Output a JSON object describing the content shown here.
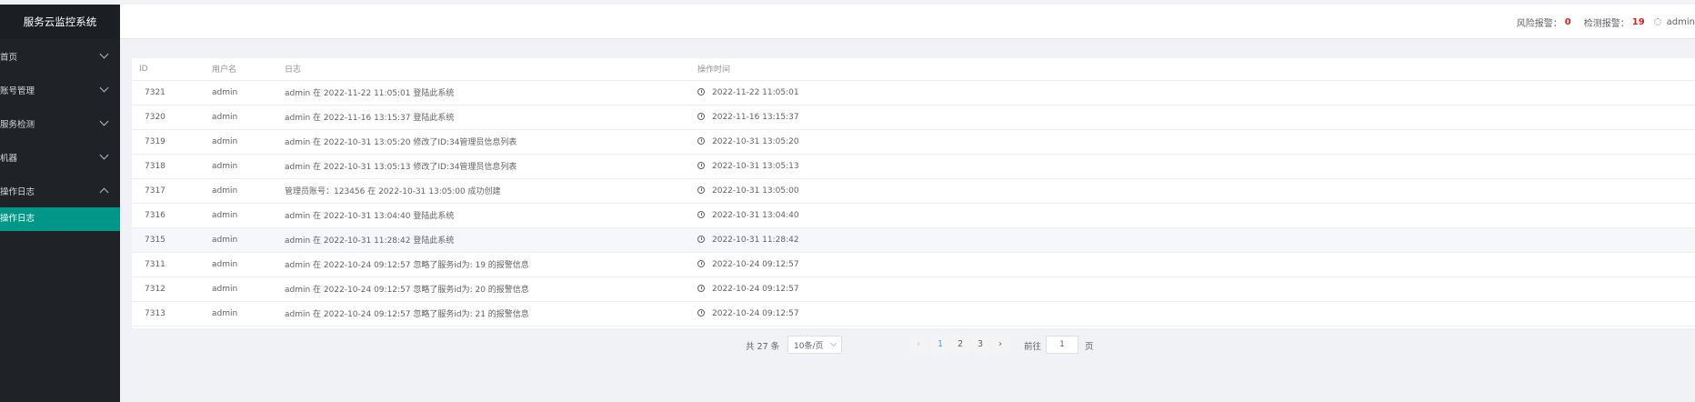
{
  "app": {
    "title": "服务云监控系统"
  },
  "sidebar": {
    "items": [
      {
        "label": "首页",
        "expanded": false
      },
      {
        "label": "账号管理",
        "expanded": false
      },
      {
        "label": "服务检测",
        "expanded": false
      },
      {
        "label": "机器",
        "expanded": false
      },
      {
        "label": "操作日志",
        "expanded": true
      }
    ],
    "submenu": {
      "label": "操作日志"
    },
    "active_color": "#009688"
  },
  "header": {
    "risk_label": "风险报警：",
    "risk_count": "0",
    "detect_label": "检测报警：",
    "detect_count": "19",
    "user": "admin"
  },
  "table": {
    "columns": [
      "ID",
      "用户名",
      "日志",
      "操作时间"
    ],
    "rows": [
      {
        "id": "7321",
        "user": "admin",
        "log": "admin 在 2022-11-22 11:05:01 登陆此系统",
        "time": "2022-11-22 11:05:01"
      },
      {
        "id": "7320",
        "user": "admin",
        "log": "admin 在 2022-11-16 13:15:37 登陆此系统",
        "time": "2022-11-16 13:15:37"
      },
      {
        "id": "7319",
        "user": "admin",
        "log": "admin 在 2022-10-31 13:05:20 修改了ID:34管理员信息列表",
        "time": "2022-10-31 13:05:20"
      },
      {
        "id": "7318",
        "user": "admin",
        "log": "admin 在 2022-10-31 13:05:13 修改了ID:34管理员信息列表",
        "time": "2022-10-31 13:05:13"
      },
      {
        "id": "7317",
        "user": "admin",
        "log": "管理员账号：123456 在 2022-10-31 13:05:00 成功创建",
        "time": "2022-10-31 13:05:00"
      },
      {
        "id": "7316",
        "user": "admin",
        "log": "admin 在 2022-10-31 13:04:40 登陆此系统",
        "time": "2022-10-31 13:04:40"
      },
      {
        "id": "7315",
        "user": "admin",
        "log": "admin 在 2022-10-31 11:28:42 登陆此系统",
        "time": "2022-10-31 11:28:42"
      },
      {
        "id": "7311",
        "user": "admin",
        "log": "admin 在 2022-10-24 09:12:57 忽略了服务id为: 19 的报警信息",
        "time": "2022-10-24 09:12:57"
      },
      {
        "id": "7312",
        "user": "admin",
        "log": "admin 在 2022-10-24 09:12:57 忽略了服务id为: 20 的报警信息",
        "time": "2022-10-24 09:12:57"
      },
      {
        "id": "7313",
        "user": "admin",
        "log": "admin 在 2022-10-24 09:12:57 忽略了服务id为: 21 的报警信息",
        "time": "2022-10-24 09:12:57"
      }
    ],
    "highlighted_row": 6
  },
  "pagination": {
    "total_label": "共 27 条",
    "page_size": "10条/页",
    "pages": [
      "1",
      "2",
      "3"
    ],
    "current_page": "1",
    "goto_label": "前往",
    "goto_value": "1",
    "page_unit": "页"
  }
}
